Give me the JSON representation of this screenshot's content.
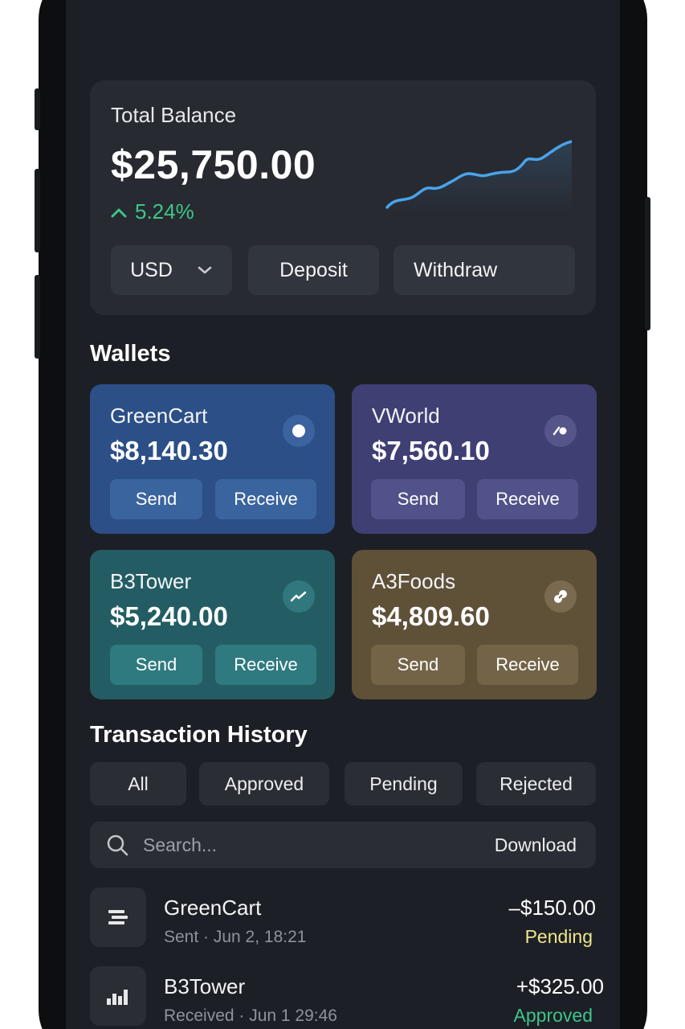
{
  "balance": {
    "label": "Total Balance",
    "amount": "$25,750.00",
    "change": "5.24%",
    "currency": "USD",
    "deposit_label": "Deposit",
    "withdraw_label": "Withdraw",
    "trend_direction": "up"
  },
  "wallets": {
    "title": "Wallets",
    "items": [
      {
        "name": "GreenCart",
        "amount": "$8,140.30",
        "send_label": "Send",
        "receive_label": "Receive",
        "color": "#2b4f86",
        "icon": "dot-icon"
      },
      {
        "name": "VWorld",
        "amount": "$7,560.10",
        "send_label": "Send",
        "receive_label": "Receive",
        "color": "#3f3f74",
        "icon": "vworld-logo-icon"
      },
      {
        "name": "B3Tower",
        "amount": "$5,240.00",
        "send_label": "Send",
        "receive_label": "Receive",
        "color": "#235d63",
        "icon": "trend-line-icon"
      },
      {
        "name": "A3Foods",
        "amount": "$4,809.60",
        "send_label": "Send",
        "receive_label": "Receive",
        "color": "#5f5038",
        "icon": "link-circles-icon"
      }
    ]
  },
  "history": {
    "title": "Transaction History",
    "filters": [
      "All",
      "Approved",
      "Pending",
      "Rejected"
    ],
    "search_placeholder": "Search...",
    "download_label": "Download",
    "transactions": [
      {
        "name": "GreenCart",
        "meta": "Sent · Jun 2, 18:21",
        "amount": "–$150.00",
        "status": "Pending",
        "status_color": "#efe68a",
        "icon": "list-icon"
      },
      {
        "name": "B3Tower",
        "meta": "Received · Jun 1 29:46",
        "amount": "+$325.00",
        "status": "Approved",
        "status_color": "#3ec58a",
        "icon": "bar-chart-icon"
      }
    ]
  },
  "colors": {
    "accent_green": "#3ec58a",
    "pending_yellow": "#efe68a",
    "sparkline_blue": "#4aa3ea"
  }
}
